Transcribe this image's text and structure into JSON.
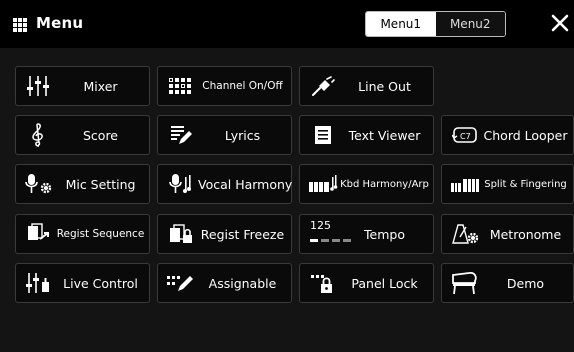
{
  "header": {
    "title": "Menu",
    "tabs": [
      {
        "label": "Menu1",
        "active": true
      },
      {
        "label": "Menu2",
        "active": false
      }
    ],
    "close_icon": "close-icon"
  },
  "buttons": {
    "mixer": {
      "label": "Mixer",
      "icon": "mixer-icon"
    },
    "channel_on_off": {
      "label": "Channel On/Off",
      "icon": "channel-grid-icon"
    },
    "line_out": {
      "label": "Line Out",
      "icon": "line-out-icon"
    },
    "score": {
      "label": "Score",
      "icon": "treble-clef-icon"
    },
    "lyrics": {
      "label": "Lyrics",
      "icon": "lyrics-pen-icon"
    },
    "text_viewer": {
      "label": "Text Viewer",
      "icon": "document-icon"
    },
    "chord_looper": {
      "label": "Chord Looper",
      "icon": "chord-loop-icon"
    },
    "mic_setting": {
      "label": "Mic Setting",
      "icon": "mic-gear-icon"
    },
    "vocal_harmony": {
      "label": "Vocal Harmony",
      "icon": "mic-harmony-icon"
    },
    "kbd_harmony": {
      "label": "Kbd Harmony/Arp",
      "icon": "keyboard-harmony-icon"
    },
    "split_fingering": {
      "label": "Split & Fingering",
      "icon": "keyboard-split-icon"
    },
    "regist_sequence": {
      "label": "Regist Sequence",
      "icon": "regist-sequence-icon"
    },
    "regist_freeze": {
      "label": "Regist Freeze",
      "icon": "regist-freeze-icon"
    },
    "tempo": {
      "label": "Tempo",
      "value": "125",
      "icon": "tempo-icon"
    },
    "metronome": {
      "label": "Metronome",
      "icon": "metronome-gear-icon"
    },
    "live_control": {
      "label": "Live Control",
      "icon": "live-control-icon"
    },
    "assignable": {
      "label": "Assignable",
      "icon": "assignable-icon"
    },
    "panel_lock": {
      "label": "Panel Lock",
      "icon": "panel-lock-icon"
    },
    "demo": {
      "label": "Demo",
      "icon": "piano-demo-icon"
    }
  },
  "colors": {
    "background": "#000000",
    "button_bg": "#0a0a0a",
    "button_border": "#3a3a3a",
    "active_tab_bg": "#ffffff"
  }
}
